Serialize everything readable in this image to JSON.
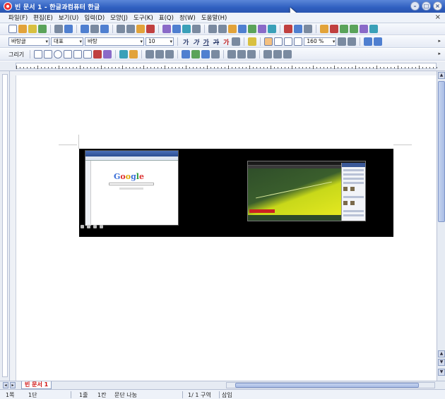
{
  "window": {
    "title": "빈 문서 1 - 한글과컴퓨터 한글",
    "controls": [
      "minimize-button",
      "maximize-button",
      "close-button"
    ]
  },
  "menubar": {
    "items": [
      "파일(F)",
      "편집(E)",
      "보기(U)",
      "입력(D)",
      "모양(J)",
      "도구(K)",
      "표(Q)",
      "창(W)",
      "도움말(H)"
    ],
    "doc_close": "×"
  },
  "format_toolbar": {
    "style": "바탕글",
    "font_group": "대표",
    "font": "바탕",
    "size": "10",
    "bold": "가",
    "italic": "가",
    "underline": "가",
    "strike": "가",
    "font_color": "가",
    "zoom": "160 %"
  },
  "draw_toolbar": {
    "label": "그리기"
  },
  "document": {
    "images": [
      {
        "name": "browser-screenshot",
        "logo": [
          "G",
          "o",
          "o",
          "g",
          "l",
          "e"
        ]
      },
      {
        "name": "game-screenshot"
      }
    ]
  },
  "tabbar": {
    "doc_tab": "빈 문서 1"
  },
  "statusbar": {
    "page": "1쪽",
    "section": "1단",
    "line": "1줄",
    "column": "1칸",
    "split": "문단 나눔",
    "page_count": "1/  1 구역",
    "mode": "삽입"
  },
  "colors": {
    "titlebar": "#2f5fc0",
    "doc_tab_text": "#d01010",
    "image_background": "#000000",
    "highlight": "#e4e820"
  },
  "icons": [
    "hwp-logo-icon",
    "new-doc-icon",
    "open-icon",
    "save-icon",
    "print-icon",
    "undo-icon",
    "redo-icon",
    "cut-icon",
    "copy-icon",
    "paste-icon",
    "table-icon",
    "chart-icon",
    "align-left-icon",
    "align-center-icon",
    "align-right-icon",
    "justify-icon",
    "line-icon",
    "rect-icon",
    "ellipse-icon",
    "arc-icon",
    "polygon-icon",
    "pen-icon"
  ]
}
